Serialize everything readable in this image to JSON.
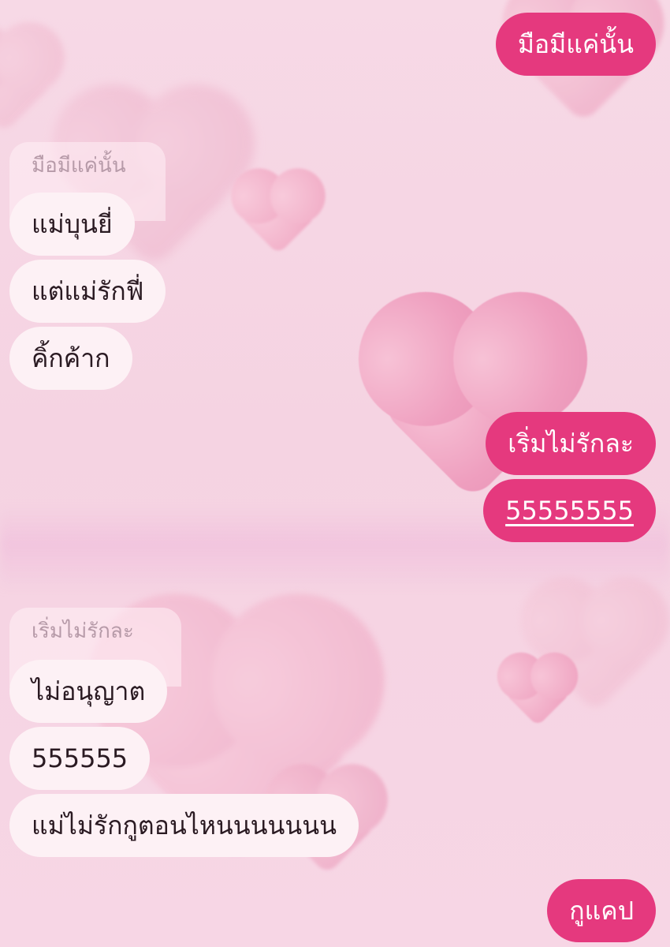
{
  "chat": {
    "messages": [
      {
        "id": "out1",
        "direction": "outgoing",
        "text": "มือมีแค่นั้น"
      },
      {
        "id": "quote1",
        "direction": "reply-reference",
        "text": "มือมีแค่นั้น"
      },
      {
        "id": "in1",
        "direction": "incoming",
        "text": "แม่บุนยี่"
      },
      {
        "id": "in2",
        "direction": "incoming",
        "text": "แต่แม่รักฟี่"
      },
      {
        "id": "in3",
        "direction": "incoming",
        "text": "คิ้กค้าก"
      },
      {
        "id": "out2",
        "direction": "outgoing",
        "text": "เริ่มไม่รักละ"
      },
      {
        "id": "out3",
        "direction": "outgoing",
        "text": "55555555"
      },
      {
        "id": "quote2",
        "direction": "reply-reference",
        "text": "เริ่มไม่รักละ"
      },
      {
        "id": "in4",
        "direction": "incoming",
        "text": "ไม่อนุญาต"
      },
      {
        "id": "in5",
        "direction": "incoming",
        "text": "555555"
      },
      {
        "id": "in6",
        "direction": "incoming",
        "text": "แม่ไม่รักกูตอนไหนนนนนนน"
      },
      {
        "id": "out4",
        "direction": "outgoing",
        "text": "กูแคป"
      }
    ]
  },
  "colors": {
    "outgoing_bubble": "#e5397e",
    "incoming_bubble": "#fdf1f5",
    "background": "#f6d6e4",
    "quote_text": "#b69aa8"
  },
  "background_decoration": "pink-hearts-wallpaper"
}
